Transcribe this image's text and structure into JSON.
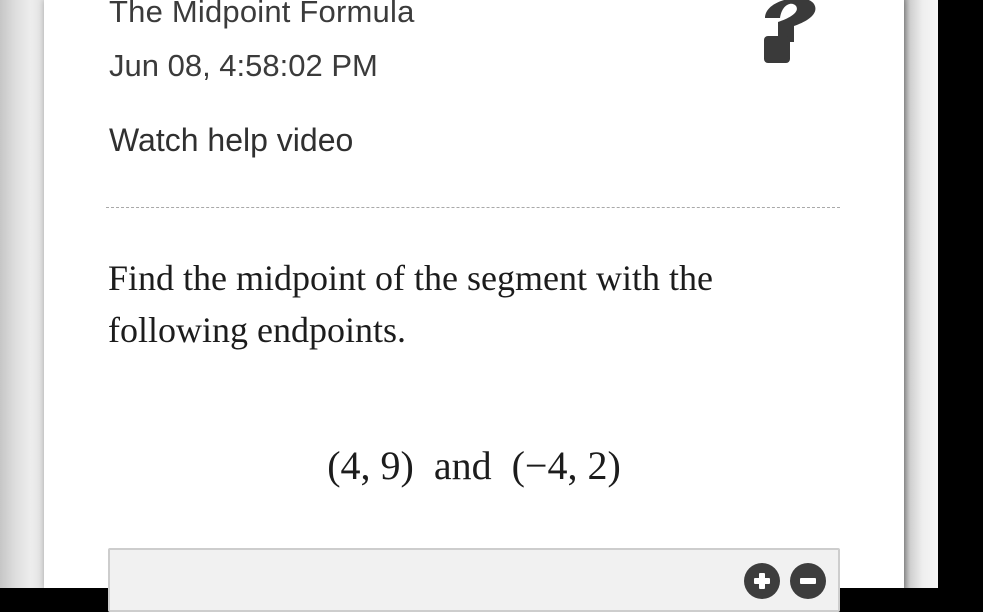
{
  "lesson": {
    "title": "The Midpoint Formula",
    "timestamp": "Jun 08, 4:58:02 PM",
    "help_link_label": "Watch help video",
    "help_icon": "question-mark-icon"
  },
  "problem": {
    "prompt": "Find the midpoint of the segment with the following endpoints.",
    "expression": "(4, 9)  and  (−4, 2)"
  },
  "answer_area": {
    "buttons": [
      {
        "icon": "plus-circle-icon"
      },
      {
        "icon": "minus-circle-icon"
      }
    ]
  },
  "colors": {
    "text": "#3b3b3b",
    "math_text": "#1c1c1c",
    "help_icon": "#3a3a3a",
    "answer_box_bg": "#f1f1f1",
    "answer_box_border": "#cdcdcd",
    "button": "#3d3d3d"
  }
}
